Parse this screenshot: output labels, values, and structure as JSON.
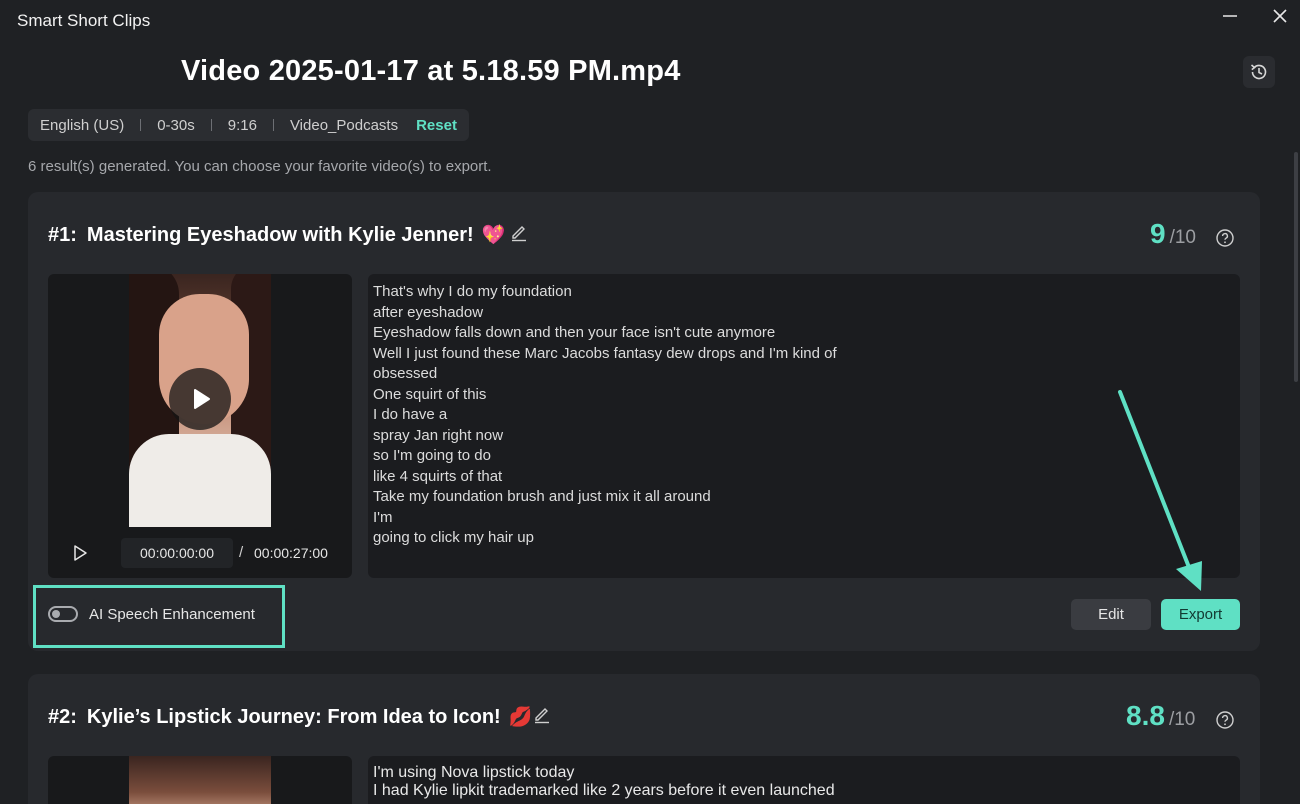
{
  "app": {
    "title": "Smart Short Clips",
    "video_title": "Video 2025-01-17 at 5.18.59 PM.mp4"
  },
  "settings": {
    "language": "English (US)",
    "duration": "0-30s",
    "ratio": "9:16",
    "template": "Video_Podcasts",
    "reset_label": "Reset"
  },
  "results_info": "6 result(s) generated. You can choose your favorite video(s) to export.",
  "clips": [
    {
      "number": "#1:",
      "title": "Mastering Eyeshadow with Kylie Jenner!",
      "emoji": "💖",
      "score": "9",
      "score_max": "/10",
      "current_time": "00:00:00:00",
      "time_separator": "/",
      "total_time": "00:00:27:00",
      "transcript": [
        "That's why I do my foundation",
        "after eyeshadow",
        "Eyeshadow falls down and then your face isn't cute anymore",
        "Well I just found these Marc Jacobs fantasy dew drops and I'm kind of",
        "obsessed",
        "One squirt of this",
        "I do have a",
        "spray Jan right now",
        "so I'm going to do",
        "like 4 squirts of that",
        "Take my foundation brush and just mix it all around",
        "I'm",
        "going to click my hair up"
      ],
      "enhancement_label": "AI Speech Enhancement",
      "enhancement_on": false,
      "edit_label": "Edit",
      "export_label": "Export"
    },
    {
      "number": "#2:",
      "title": "Kylie’s Lipstick Journey: From Idea to Icon!",
      "emoji": "💋",
      "score": "8.8",
      "score_max": "/10",
      "transcript": [
        "I'm using Nova lipstick today",
        "I had Kylie lipkit trademarked like 2 years before it even launched"
      ]
    }
  ],
  "colors": {
    "accent": "#5fe0c4",
    "background": "#1f2124",
    "card": "#27292d"
  }
}
